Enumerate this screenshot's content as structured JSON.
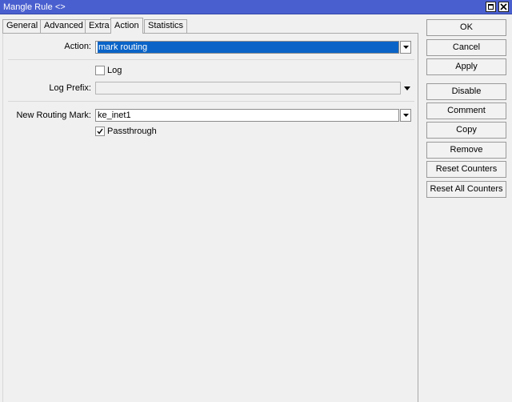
{
  "window": {
    "title": "Mangle Rule <>"
  },
  "tabs": [
    {
      "label": "General"
    },
    {
      "label": "Advanced"
    },
    {
      "label": "Extra"
    },
    {
      "label": "Action"
    },
    {
      "label": "Statistics"
    }
  ],
  "active_tab": "Action",
  "form": {
    "action": {
      "label": "Action:",
      "value": "mark routing"
    },
    "log": {
      "label": "Log",
      "checked": false
    },
    "log_prefix": {
      "label": "Log Prefix:",
      "value": ""
    },
    "new_routing_mark": {
      "label": "New Routing Mark:",
      "value": "ke_inet1"
    },
    "passthrough": {
      "label": "Passthrough",
      "checked": true
    }
  },
  "buttons": {
    "ok": "OK",
    "cancel": "Cancel",
    "apply": "Apply",
    "disable": "Disable",
    "comment": "Comment",
    "copy": "Copy",
    "remove": "Remove",
    "reset_counters": "Reset Counters",
    "reset_all_counters": "Reset All Counters"
  },
  "colors": {
    "titlebar": "#4a5fcf",
    "selection": "#0a64c8"
  }
}
